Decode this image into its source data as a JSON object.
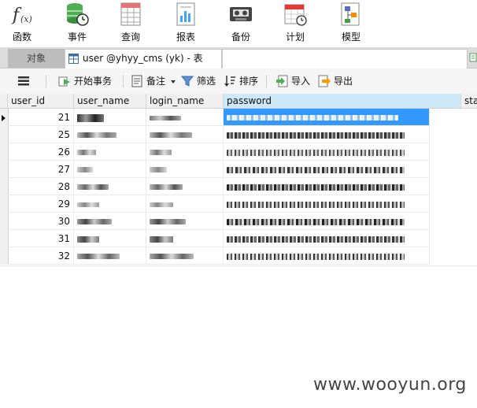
{
  "ribbon": {
    "items": [
      {
        "label": "函数",
        "icon": "function-icon"
      },
      {
        "label": "事件",
        "icon": "event-icon"
      },
      {
        "label": "查询",
        "icon": "query-icon"
      },
      {
        "label": "报表",
        "icon": "report-icon"
      },
      {
        "label": "备份",
        "icon": "backup-icon"
      },
      {
        "label": "计划",
        "icon": "schedule-icon"
      },
      {
        "label": "模型",
        "icon": "model-icon"
      }
    ]
  },
  "tabs": {
    "objects": "对象",
    "table_tab": "user @yhyy_cms (yk) - 表"
  },
  "toolbar": {
    "menu": "menu-icon",
    "begin_transaction": "开始事务",
    "memo": "备注",
    "filter": "筛选",
    "sort": "排序",
    "import": "导入",
    "export": "导出"
  },
  "grid": {
    "columns": [
      "user_id",
      "user_name",
      "login_name",
      "password",
      "sta"
    ],
    "rows": [
      {
        "user_id": "21",
        "selected": true
      },
      {
        "user_id": "25",
        "selected": false
      },
      {
        "user_id": "26",
        "selected": false
      },
      {
        "user_id": "27",
        "selected": false
      },
      {
        "user_id": "28",
        "selected": false
      },
      {
        "user_id": "29",
        "selected": false
      },
      {
        "user_id": "30",
        "selected": false
      },
      {
        "user_id": "31",
        "selected": false
      },
      {
        "user_id": "32",
        "selected": false
      }
    ]
  },
  "watermark": "www.wooyun.org",
  "colors": {
    "selection": "#3399ff",
    "header_selected": "#cde8f7",
    "tabbar": "#dcdcdc"
  }
}
